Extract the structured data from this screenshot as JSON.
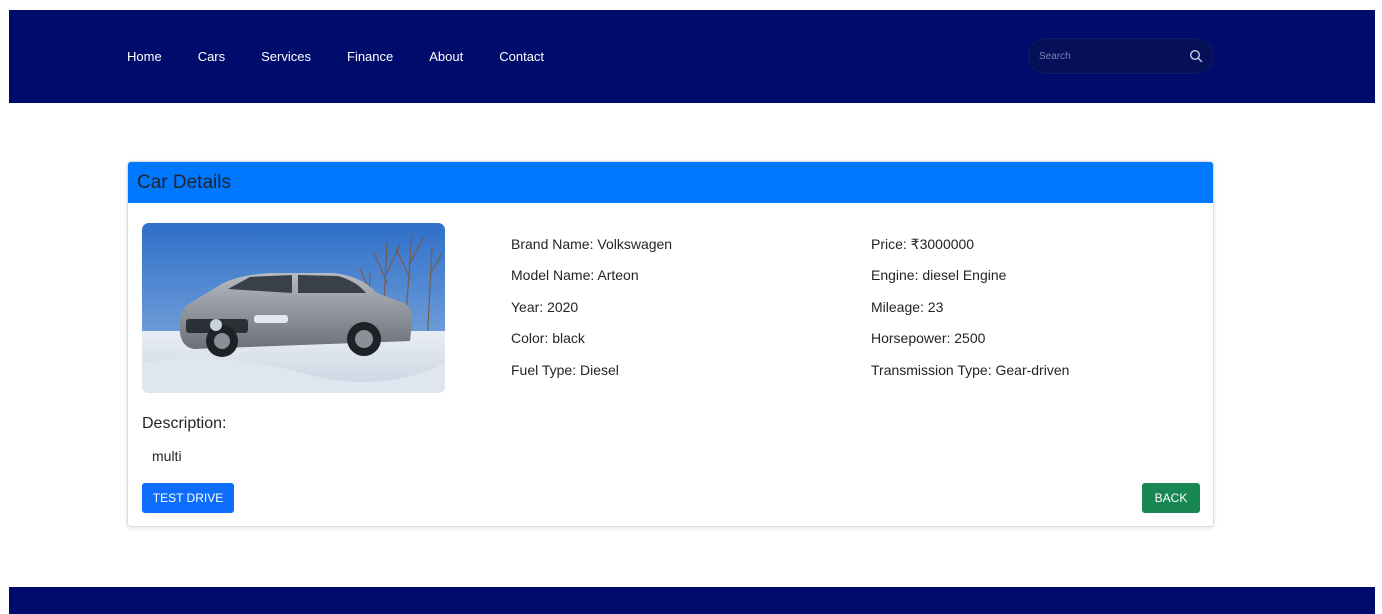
{
  "nav": {
    "links": [
      "Home",
      "Cars",
      "Services",
      "Finance",
      "About",
      "Contact"
    ],
    "search_placeholder": "Search",
    "search_icon": "search-icon",
    "background": "#000c6b"
  },
  "card": {
    "title": "Car Details",
    "header_color": "#0077ff",
    "details_left": [
      "Brand Name: Volkswagen",
      "Model Name: Arteon",
      "Year: 2020",
      "Color: black",
      "Fuel Type: Diesel"
    ],
    "details_right": [
      "Price: ₹3000000",
      "Engine: diesel Engine",
      "Mileage: 23",
      "Horsepower: 2500",
      "Transmission Type: Gear-driven"
    ],
    "description_label": "Description:",
    "description": "multi",
    "test_drive_label": "TEST DRIVE",
    "back_label": "BACK",
    "test_drive_color": "#0d6efd",
    "back_color": "#198754"
  }
}
